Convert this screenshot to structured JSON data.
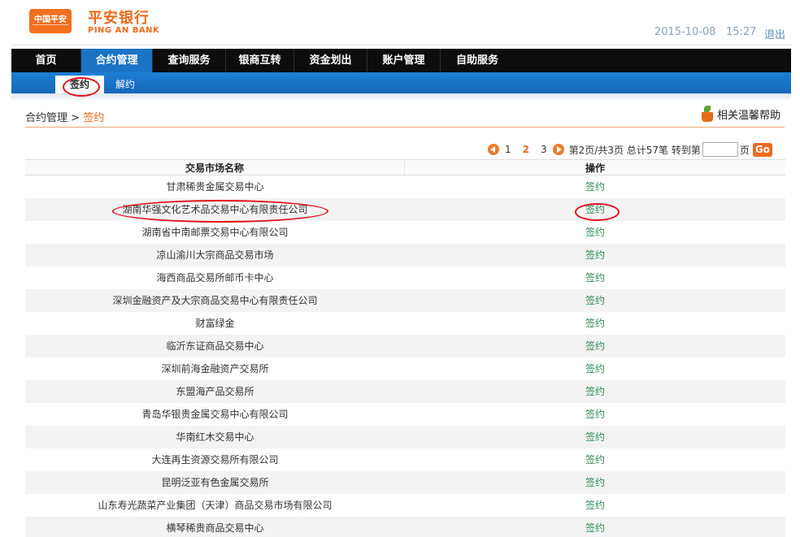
{
  "header": {
    "logo_text": "中国平安",
    "brand_cn": "平安银行",
    "brand_en": "PING AN BANK",
    "datetime": "2015-10-08   15:27",
    "logout": "退出"
  },
  "main_nav": [
    "首页",
    "合约管理",
    "查询服务",
    "银商互转",
    "资金划出",
    "账户管理",
    "自助服务"
  ],
  "sub_nav": {
    "active": "签约",
    "other": "解约"
  },
  "breadcrumb": {
    "parent": "合约管理",
    "separator": ">",
    "current": "签约"
  },
  "help": "相关温馨帮助",
  "pager": {
    "pages": [
      "1",
      "2",
      "3"
    ],
    "current": "2",
    "summary": "第2页/共3页 总计57笔 转到第",
    "suffix": "页",
    "go": "Go"
  },
  "table": {
    "headers": [
      "交易市场名称",
      "操作"
    ],
    "rows": [
      {
        "name": "甘肃稀贵金属交易中心",
        "action": "签约"
      },
      {
        "name": "湖南华强文化艺术品交易中心有限责任公司",
        "action": "签约"
      },
      {
        "name": "湖南省中南邮票交易中心有限公司",
        "action": "签约"
      },
      {
        "name": "凉山渝川大宗商品交易市场",
        "action": "签约"
      },
      {
        "name": "海西商品交易所邮币卡中心",
        "action": "签约"
      },
      {
        "name": "深圳金融资产及大宗商品交易中心有限责任公司",
        "action": "签约"
      },
      {
        "name": "财富绿金",
        "action": "签约"
      },
      {
        "name": "临沂东证商品交易中心",
        "action": "签约"
      },
      {
        "name": "深圳前海金融资产交易所",
        "action": "签约"
      },
      {
        "name": "东盟海产品交易所",
        "action": "签约"
      },
      {
        "name": "青岛华银贵金属交易中心有限公司",
        "action": "签约"
      },
      {
        "name": "华南红木交易中心",
        "action": "签约"
      },
      {
        "name": "大连再生资源交易所有限公司",
        "action": "签约"
      },
      {
        "name": "昆明泛亚有色金属交易所",
        "action": "签约"
      },
      {
        "name": "山东寿光蔬菜产业集团（天津）商品交易市场有限公司",
        "action": "签约"
      },
      {
        "name": "横琴稀贵商品交易中心",
        "action": "签约"
      }
    ]
  },
  "colors": {
    "brand_orange": "#ee6a1c",
    "nav_black": "#0d0d0d",
    "nav_blue": "#1b73c6",
    "link_green": "#2e8b57",
    "annotation_red": "#e0101b"
  }
}
